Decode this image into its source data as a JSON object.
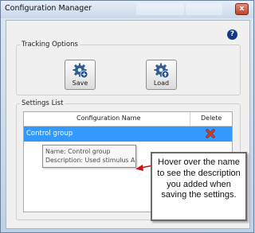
{
  "window": {
    "title": "Configuration Manager",
    "close_glyph": "x"
  },
  "help_icon": {
    "glyph": "?"
  },
  "tracking_options": {
    "legend": "Tracking Options",
    "save_label": "Save",
    "load_label": "Load"
  },
  "settings_list": {
    "legend": "Settings List",
    "columns": [
      "Configuration Name",
      "Delete"
    ],
    "rows": [
      {
        "name": "Control group"
      }
    ]
  },
  "tooltip": {
    "name_line": "Name: Control group",
    "description_line": "Description: Used stimulus A"
  },
  "callout": {
    "text": "Hover over the name to see the description you added when saving the settings."
  },
  "colors": {
    "selection": "#3399ff",
    "delete_icon": "#cc2200",
    "arrow": "#cc1111",
    "help_icon": "#123a86"
  },
  "icons": [
    "gear-plus-icon",
    "gear-upload-icon",
    "delete-x-icon",
    "help-icon",
    "close-icon"
  ]
}
